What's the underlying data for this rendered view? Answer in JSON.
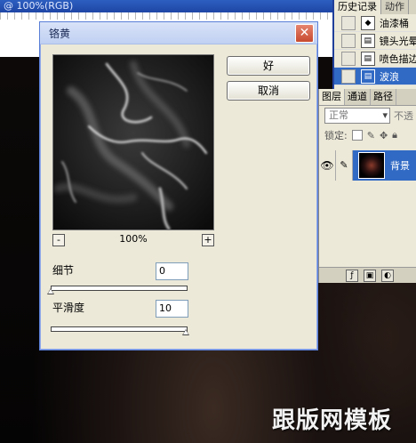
{
  "document": {
    "title": "@ 100%(RGB)"
  },
  "history": {
    "tabs": [
      "历史记录",
      "动作"
    ],
    "items": [
      {
        "label": "油漆桶",
        "selected": false
      },
      {
        "label": "镜头光晕",
        "selected": false
      },
      {
        "label": "喷色描边",
        "selected": false
      },
      {
        "label": "波浪",
        "selected": true
      }
    ]
  },
  "layers": {
    "tabs": [
      "图层",
      "通道",
      "路径"
    ],
    "blend_mode": "正常",
    "opacity_label": "不透",
    "lock_label": "锁定:",
    "layer_name": "背景"
  },
  "dialog": {
    "title": "铬黄",
    "ok_label": "好",
    "cancel_label": "取消",
    "zoom": "100%",
    "zoom_minus": "-",
    "zoom_plus": "+",
    "detail_label": "细节",
    "detail_value": "0",
    "detail_fraction": 0,
    "smooth_label": "平滑度",
    "smooth_value": "10",
    "smooth_fraction": 1
  },
  "watermark": "跟版网模板"
}
